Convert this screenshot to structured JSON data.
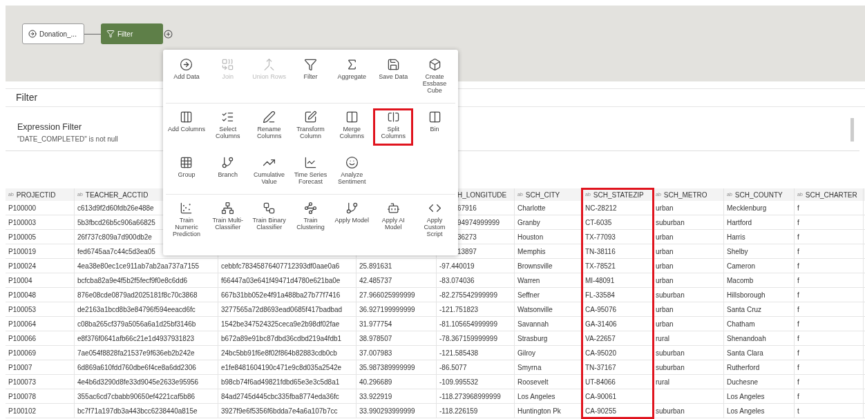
{
  "flow": {
    "nodes": [
      {
        "label": "Donation_...",
        "selected": false
      },
      {
        "label": "Filter",
        "selected": true
      }
    ]
  },
  "step_menu": {
    "sections": [
      [
        {
          "label": "Add Data",
          "disabled": false
        },
        {
          "label": "Join",
          "disabled": true
        },
        {
          "label": "Union Rows",
          "disabled": true
        },
        {
          "label": "Filter",
          "disabled": false
        },
        {
          "label": "Aggregate",
          "disabled": false
        },
        {
          "label": "Save Data",
          "disabled": false
        },
        {
          "label": "Create Essbase Cube",
          "disabled": false
        }
      ],
      [
        {
          "label": "Add Columns",
          "disabled": false
        },
        {
          "label": "Select Columns",
          "disabled": false
        },
        {
          "label": "Rename Columns",
          "disabled": false
        },
        {
          "label": "Transform Column",
          "disabled": false
        },
        {
          "label": "Merge Columns",
          "disabled": false
        },
        {
          "label": "Split Columns",
          "disabled": false,
          "highlighted": true
        },
        {
          "label": "Bin",
          "disabled": false
        }
      ],
      [
        {
          "label": "Group",
          "disabled": false
        },
        {
          "label": "Branch",
          "disabled": false
        },
        {
          "label": "Cumulative Value",
          "disabled": false
        },
        {
          "label": "Time Series Forecast",
          "disabled": false
        },
        {
          "label": "Analyze Sentiment",
          "disabled": false
        }
      ],
      [
        {
          "label": "Train Numeric Prediction",
          "disabled": false
        },
        {
          "label": "Train Multi-Classifier",
          "disabled": false
        },
        {
          "label": "Train Binary Classifier",
          "disabled": false
        },
        {
          "label": "Train Clustering",
          "disabled": false
        },
        {
          "label": "Apply Model",
          "disabled": false
        },
        {
          "label": "Apply AI Model",
          "disabled": false
        },
        {
          "label": "Apply Custom Script",
          "disabled": false
        }
      ]
    ]
  },
  "step_panel": {
    "title": "Filter",
    "filter": {
      "title": "Expression Filter",
      "expression": "\"DATE_COMPLETED\" is not null"
    }
  },
  "table": {
    "columns": [
      {
        "badge": "ab",
        "label": "PROJECTID"
      },
      {
        "badge": "ab",
        "label": "TEACHER_ACCTID"
      },
      null,
      null,
      {
        "label": "H_LONGITUDE"
      },
      {
        "badge": "ab",
        "label": "SCH_CITY"
      },
      {
        "badge": "ab",
        "label": "SCH_STATEZIP",
        "highlighted": true
      },
      {
        "badge": "ab",
        "label": "SCH_METRO"
      },
      {
        "badge": "ab",
        "label": "SCH_COUNTY"
      },
      {
        "badge": "ab",
        "label": "SCH_CHARTER"
      }
    ],
    "rows": [
      [
        "P100000",
        "c613d9f2d60fdb26e488e",
        null,
        null,
        "67916",
        "Charlotte",
        "NC-28212",
        "urban",
        "Mecklenburg",
        "f"
      ],
      [
        "P100003",
        "5b3fbcd26b5c906a66825",
        null,
        null,
        "94974999999",
        "Granby",
        "CT-6035",
        "suburban",
        "Hartford",
        "f"
      ],
      [
        "P100005",
        "26f737c809a7d900db2e",
        null,
        null,
        "36273",
        "Houston",
        "TX-77093",
        "urban",
        "Harris",
        "f"
      ],
      [
        "P100019",
        "fed6745aa7c44c5d3ea05",
        null,
        null,
        "13897",
        "Memphis",
        "TN-38116",
        "urban",
        "Shelby",
        "f"
      ],
      [
        "P100024",
        "4ea38e80ec1ce911ab7ab2aa737a7155",
        "cebbfc78345876407712393df0aae0a6",
        "25.891631",
        "-97.440019",
        "Brownsville",
        "TX-78521",
        "urban",
        "Cameron",
        "f"
      ],
      [
        "P10004",
        "bcfcba82a9e4f5b2f5fecf9f0e8c6dd6",
        "f66447a03e641f49471d4780e621ba0e",
        "42.485737",
        "-83.074036",
        "Warren",
        "MI-48091",
        "urban",
        "Macomb",
        "f"
      ],
      [
        "P100048",
        "876e08cde0879ad2025181f8c70c3868",
        "667b31bb052e4f91a488ba27b77f7416",
        "27.966025999999",
        "-82.275542999999",
        "Seffner",
        "FL-33584",
        "suburban",
        "Hillsborough",
        "f"
      ],
      [
        "P100053",
        "de2163a1bcd8b3e84796f594eeacd6fc",
        "3277565a72d8693ead0685f417badbad",
        "36.927199999999",
        "-121.751823",
        "Watsonville",
        "CA-95076",
        "urban",
        "Santa Cruz",
        "f"
      ],
      [
        "P100064",
        "c08ba265cf379a5056a6a1d25bf3146b",
        "1542be347524325ceca9e2b98df02fae",
        "31.977754",
        "-81.105654999999",
        "Savannah",
        "GA-31406",
        "urban",
        "Chatham",
        "f"
      ],
      [
        "P100066",
        "e8f376f0641afb66c21e1d4937931823",
        "b672a89e91bc87dbd36cdbd219a4fdb1",
        "38.978507",
        "-78.367159999999",
        "Strasburg",
        "VA-22657",
        "rural",
        "Shenandoah",
        "f"
      ],
      [
        "P100069",
        "7ae054f8828fa21537e9f636eb2b242e",
        "24bc5bb91f6e8f02f864b82883cdb0cb",
        "37.007983",
        "-121.585438",
        "Gilroy",
        "CA-95020",
        "suburban",
        "Santa Clara",
        "f"
      ],
      [
        "P10007",
        "6d869a610fdd760dbe6f4ce8a6dd2306",
        "e1fe8481604190c471e9c8d035a2542e",
        "35.987389999999",
        "-86.5077",
        "Smyrna",
        "TN-37167",
        "suburban",
        "Rutherford",
        "f"
      ],
      [
        "P100073",
        "4e4b6d3290d8fe33d9045e2633e95956",
        "b98cb74f6ad49821fdbd65e3e3c5d8a1",
        "40.296689",
        "-109.995532",
        "Roosevelt",
        "UT-84066",
        "rural",
        "Duchesne",
        "f"
      ],
      [
        "P100078",
        "355ac6cd7cbabb90650ef4221caf5b86",
        "84ad2745d445cbc335fba8774eda36fc",
        "33.922919",
        "-118.273968999999",
        "Los Angeles",
        "CA-90061",
        null,
        "Los Angeles",
        "f"
      ],
      [
        "P100102",
        "bc7f71a197db3a443bcc6238440a815e",
        "3927f9e6f5356f6bdda7e4a6a107b7cc",
        "33.990293999999",
        "-118.226159",
        "Huntington Pk",
        "CA-90255",
        "suburban",
        "Los Angeles",
        "t"
      ]
    ]
  }
}
